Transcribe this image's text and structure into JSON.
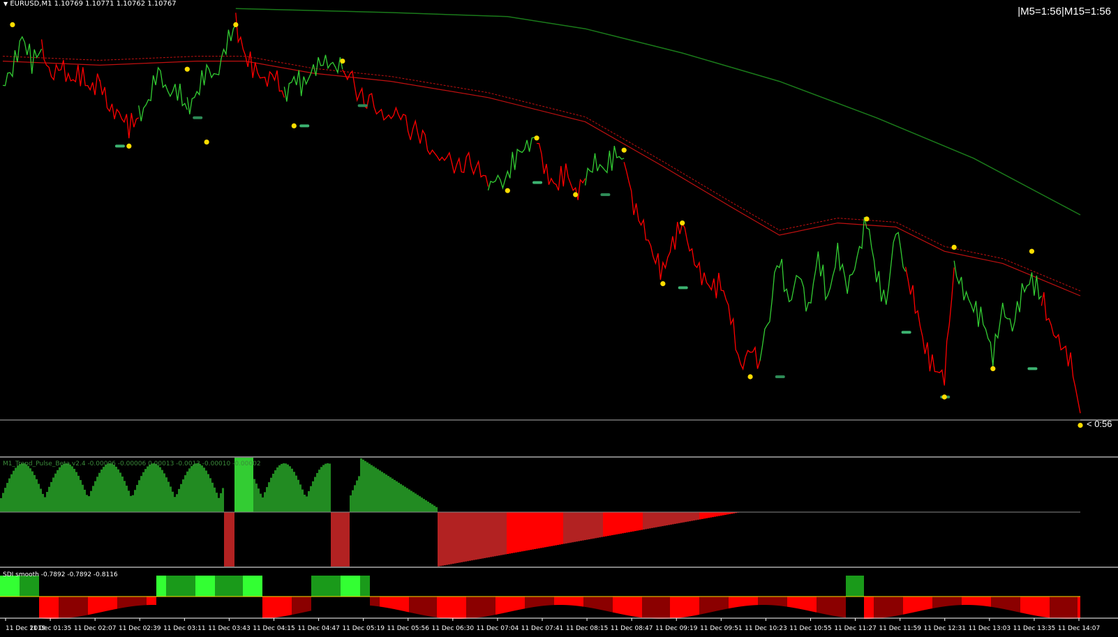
{
  "header": {
    "symbol_info": "EURUSD,M1  1.10769 1.10771 1.10762 1.10767",
    "timer": "|M5=1:56|M15=1:56",
    "countdown": "< 0:56"
  },
  "indicators": {
    "trend_pulse_label": "M1_Trend_Pulse_Beta v2.4 -0.00006 -0.00006 0.00013 -0.0013  -0.00010 -0.00002",
    "sdi_label": "SDI smooth -0.7892 -0.7892 -0.8116"
  },
  "colors": {
    "bull": "#33cc33",
    "bear": "#ff0000",
    "bull_dark": "#228b22",
    "bear_dark": "#b22222",
    "dot": "#ffdd00",
    "ma_long": "#1a7a1a",
    "ma_mid": "#c01010",
    "panel_border": "#ffffff"
  },
  "chart_data": {
    "type": "line",
    "title": "EURUSD,M1",
    "x_tick_labels": [
      "11 Dec 2019",
      "11 Dec 01:35",
      "11 Dec 02:07",
      "11 Dec 02:39",
      "11 Dec 03:11",
      "11 Dec 03:43",
      "11 Dec 04:15",
      "11 Dec 04:47",
      "11 Dec 05:19",
      "11 Dec 05:56",
      "11 Dec 06:30",
      "11 Dec 07:04",
      "11 Dec 07:41",
      "11 Dec 08:15",
      "11 Dec 08:47",
      "11 Dec 09:19",
      "11 Dec 09:51",
      "11 Dec 10:23",
      "11 Dec 10:55",
      "11 Dec 11:27",
      "11 Dec 11:59",
      "11 Dec 12:31",
      "11 Dec 13:03",
      "11 Dec 13:35",
      "11 Dec 14:07"
    ],
    "ylim": [
      0,
      100
    ],
    "price_series": [
      {
        "trend": "bull",
        "points": [
          [
            0,
            82
          ],
          [
            1,
            86
          ],
          [
            2,
            94
          ],
          [
            3,
            88
          ],
          [
            4,
            91
          ]
        ]
      },
      {
        "trend": "bear",
        "points": [
          [
            4,
            91
          ],
          [
            5,
            84
          ],
          [
            6,
            87
          ],
          [
            7,
            83
          ],
          [
            8,
            85
          ],
          [
            9,
            81
          ],
          [
            10,
            83
          ]
        ]
      },
      {
        "trend": "bear",
        "points": [
          [
            10,
            83
          ],
          [
            11,
            76
          ],
          [
            12,
            75
          ],
          [
            13,
            72
          ],
          [
            14,
            74
          ]
        ]
      },
      {
        "trend": "bull",
        "points": [
          [
            14,
            74
          ],
          [
            15,
            78
          ],
          [
            16,
            86
          ],
          [
            17,
            80
          ],
          [
            18,
            81
          ],
          [
            19,
            76
          ]
        ]
      },
      {
        "trend": "bull",
        "points": [
          [
            19,
            76
          ],
          [
            20,
            80
          ],
          [
            21,
            86
          ],
          [
            22,
            84
          ],
          [
            23,
            92
          ],
          [
            24,
            97
          ]
        ]
      },
      {
        "trend": "bear",
        "points": [
          [
            24,
            97
          ],
          [
            25,
            89
          ],
          [
            26,
            86
          ],
          [
            27,
            83
          ],
          [
            28,
            85
          ],
          [
            29,
            79
          ]
        ]
      },
      {
        "trend": "bull",
        "points": [
          [
            29,
            79
          ],
          [
            30,
            84
          ],
          [
            31,
            82
          ],
          [
            32,
            86
          ],
          [
            33,
            88
          ],
          [
            34,
            87
          ],
          [
            35,
            86
          ]
        ]
      },
      {
        "trend": "bear",
        "points": [
          [
            35,
            86
          ],
          [
            37,
            80
          ],
          [
            39,
            75
          ],
          [
            41,
            74
          ],
          [
            43,
            69
          ],
          [
            45,
            64
          ],
          [
            47,
            63
          ],
          [
            49,
            62
          ],
          [
            50,
            57
          ]
        ]
      },
      {
        "trend": "bull",
        "points": [
          [
            50,
            57
          ],
          [
            52,
            60
          ],
          [
            53,
            65
          ],
          [
            54,
            67
          ],
          [
            55,
            69
          ]
        ]
      },
      {
        "trend": "bear",
        "points": [
          [
            55,
            69
          ],
          [
            56,
            60
          ],
          [
            57,
            57
          ],
          [
            58,
            61
          ],
          [
            59,
            55
          ],
          [
            60,
            59
          ]
        ]
      },
      {
        "trend": "bull",
        "points": [
          [
            60,
            59
          ],
          [
            61,
            63
          ],
          [
            62,
            61
          ],
          [
            63,
            65
          ],
          [
            64,
            64
          ]
        ]
      },
      {
        "trend": "bear",
        "points": [
          [
            64,
            64
          ],
          [
            65,
            52
          ],
          [
            66,
            47
          ],
          [
            67,
            40
          ],
          [
            68,
            36
          ],
          [
            69,
            43
          ],
          [
            70,
            48
          ],
          [
            71,
            40
          ],
          [
            72,
            35
          ],
          [
            73,
            32
          ],
          [
            74,
            33
          ],
          [
            75,
            25
          ],
          [
            76,
            12
          ],
          [
            77,
            17
          ],
          [
            78,
            14
          ]
        ]
      },
      {
        "trend": "bull",
        "points": [
          [
            78,
            14
          ],
          [
            80,
            39
          ],
          [
            81,
            28
          ],
          [
            82,
            36
          ],
          [
            83,
            26
          ],
          [
            84,
            40
          ],
          [
            85,
            29
          ],
          [
            86,
            41
          ],
          [
            87,
            32
          ],
          [
            88,
            39
          ],
          [
            89,
            49
          ],
          [
            90,
            35
          ],
          [
            91,
            28
          ],
          [
            92,
            47
          ],
          [
            93,
            36
          ]
        ]
      },
      {
        "trend": "bear",
        "points": [
          [
            93,
            36
          ],
          [
            94,
            28
          ],
          [
            95,
            17
          ],
          [
            96,
            12
          ],
          [
            97,
            10
          ],
          [
            98,
            37
          ]
        ]
      },
      {
        "trend": "bull",
        "points": [
          [
            98,
            37
          ],
          [
            99,
            31
          ],
          [
            100,
            27
          ],
          [
            101,
            24
          ],
          [
            102,
            15
          ],
          [
            103,
            27
          ],
          [
            104,
            22
          ],
          [
            105,
            31
          ],
          [
            106,
            34
          ],
          [
            107,
            30
          ]
        ]
      },
      {
        "trend": "bear",
        "points": [
          [
            107,
            30
          ],
          [
            108,
            22
          ],
          [
            109,
            18
          ],
          [
            110,
            14
          ],
          [
            111,
            1
          ]
        ]
      }
    ],
    "ma_long": [
      [
        24,
        101
      ],
      [
        40,
        100
      ],
      [
        52,
        99
      ],
      [
        60,
        96
      ],
      [
        70,
        90
      ],
      [
        80,
        83
      ],
      [
        90,
        74
      ],
      [
        100,
        64
      ],
      [
        111,
        50
      ]
    ],
    "ma_mid": [
      [
        0,
        88
      ],
      [
        10,
        87
      ],
      [
        20,
        88
      ],
      [
        25,
        88
      ],
      [
        32,
        85
      ],
      [
        40,
        83
      ],
      [
        50,
        79
      ],
      [
        60,
        73
      ],
      [
        68,
        62
      ],
      [
        75,
        52
      ],
      [
        80,
        45
      ],
      [
        86,
        48
      ],
      [
        92,
        47
      ],
      [
        97,
        41
      ],
      [
        103,
        38
      ],
      [
        107,
        34
      ],
      [
        111,
        30
      ]
    ],
    "swing_dots": [
      [
        1,
        97
      ],
      [
        19,
        86
      ],
      [
        24,
        97
      ],
      [
        35,
        88
      ],
      [
        55,
        69
      ],
      [
        64,
        66
      ],
      [
        70,
        48
      ],
      [
        89,
        49
      ],
      [
        98,
        42
      ],
      [
        106,
        41
      ],
      [
        13,
        67
      ],
      [
        21,
        68
      ],
      [
        30,
        72
      ],
      [
        52,
        56
      ],
      [
        59,
        55
      ],
      [
        68,
        33
      ],
      [
        77,
        10
      ],
      [
        97,
        5
      ],
      [
        102,
        12
      ],
      [
        111,
        -2
      ]
    ],
    "stops": [
      [
        12,
        67
      ],
      [
        20,
        74
      ],
      [
        31,
        72
      ],
      [
        37,
        77
      ],
      [
        55,
        58
      ],
      [
        62,
        55
      ],
      [
        70,
        32
      ],
      [
        80,
        10
      ],
      [
        93,
        21
      ],
      [
        97,
        5
      ],
      [
        106,
        12
      ]
    ]
  }
}
